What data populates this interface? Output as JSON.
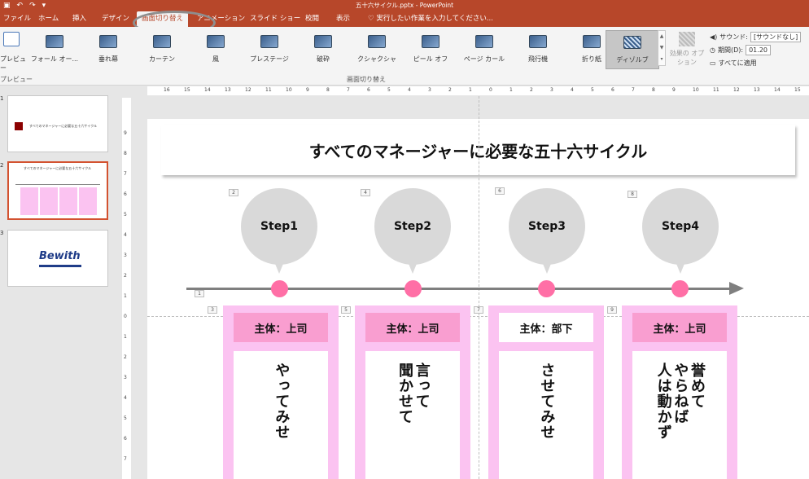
{
  "titlebar": {
    "document_title": "五十六サイクル.pptx - PowerPoint",
    "quick_access": [
      "save-icon",
      "undo-icon",
      "redo-icon",
      "customize-icon"
    ]
  },
  "menu": {
    "tabs": [
      "ファイル",
      "ホーム",
      "挿入",
      "デザイン",
      "画面切り替え",
      "アニメーション",
      "スライド ショー",
      "校閲",
      "表示"
    ],
    "active_tab": "画面切り替え",
    "tell_me": "実行したい作業を入力してください..."
  },
  "ribbon": {
    "preview_label": "プレビュー",
    "preview_group": "プレビュー",
    "transitions_group": "画面切り替え",
    "effects": [
      "フォール オー...",
      "垂れ幕",
      "カーテン",
      "風",
      "プレステージ",
      "破砕",
      "クシャクシャ",
      "ピール オフ",
      "ページ カール",
      "飛行機",
      "折り紙",
      "ディゾルブ"
    ],
    "selected_effect": "ディゾルブ",
    "effect_options_label": "効果の オプション",
    "sound_label": "サウンド:",
    "sound_value": "[サウンドなし]",
    "duration_label": "期間(D):",
    "duration_value": "01.20",
    "apply_all_label": "すべてに適用"
  },
  "thumbnails": {
    "numbers": [
      "1",
      "2",
      "3"
    ],
    "slide1_text": "すべてのマネージャーに必要な五十六サイクル",
    "slide3_logo": "Bewith"
  },
  "ruler": {
    "h_ticks": [
      "16",
      "15",
      "14",
      "13",
      "12",
      "11",
      "10",
      "9",
      "8",
      "7",
      "6",
      "5",
      "4",
      "3",
      "2",
      "1",
      "0",
      "1",
      "2",
      "3",
      "4",
      "5",
      "6",
      "7",
      "8",
      "9",
      "10",
      "11",
      "12",
      "13",
      "14",
      "15",
      "16"
    ],
    "v_ticks": [
      "9",
      "8",
      "7",
      "6",
      "5",
      "4",
      "3",
      "2",
      "1",
      "0",
      "1",
      "2",
      "3",
      "4",
      "5",
      "6",
      "7"
    ]
  },
  "slide": {
    "title": "すべてのマネージャーに必要な五十六サイクル",
    "steps": [
      "Step1",
      "Step2",
      "Step3",
      "Step4"
    ],
    "cards": [
      {
        "head": "主体：上司",
        "body": "やってみせ"
      },
      {
        "head": "主体：上司",
        "body": "言って\n聞かせて"
      },
      {
        "head": "主体：部下",
        "body": "させてみせ"
      },
      {
        "head": "主体：上司",
        "body": "誉めて\nやらねば\n人は動かず"
      }
    ],
    "anim_tags": [
      "1",
      "2",
      "3",
      "4",
      "5",
      "6",
      "7",
      "8",
      "9"
    ],
    "colors": {
      "card": "#fbc3f1",
      "card_head": "#f99ed0",
      "dot": "#ff6fa6",
      "pin": "#d9d9d9",
      "arrow": "#7f7f7f"
    }
  }
}
